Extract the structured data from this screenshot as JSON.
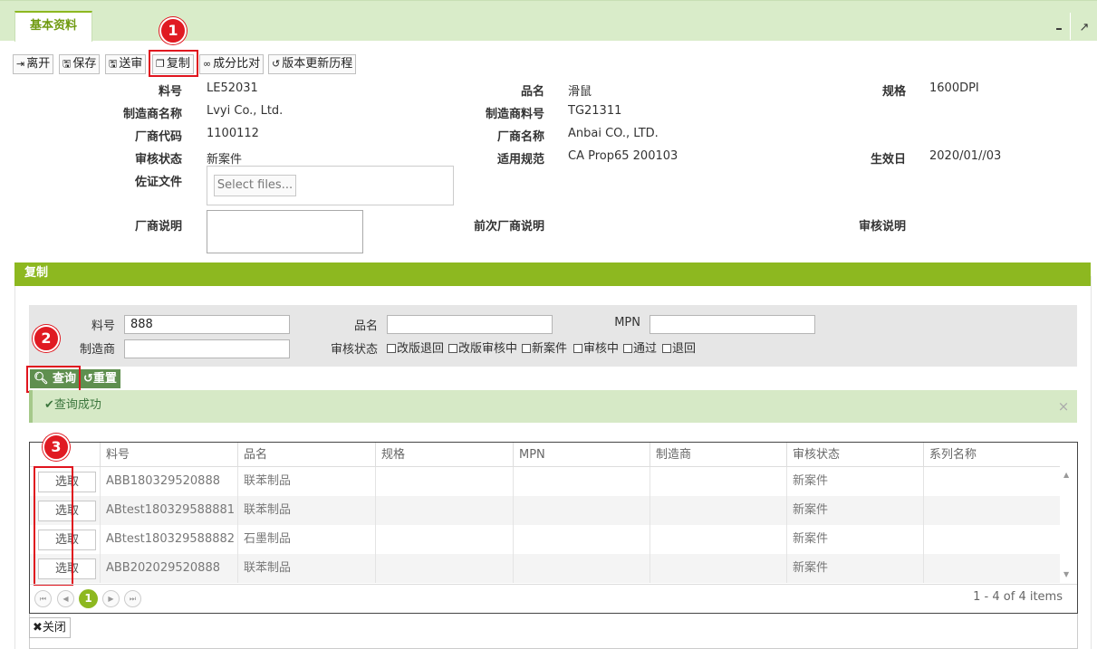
{
  "tab": {
    "label": "基本资料"
  },
  "window": {
    "minimize": "–",
    "maximize": "↗"
  },
  "toolbar": {
    "leave": "离开",
    "save": "保存",
    "submit": "送审",
    "copy": "复制",
    "compare": "成分比对",
    "history": "版本更新历程"
  },
  "badges": {
    "one": "1",
    "two": "2",
    "three": "3"
  },
  "form": {
    "part_no_label": "料号",
    "part_no": "LE52031",
    "product_name_label": "品名",
    "product_name": "滑鼠",
    "spec_label": "规格",
    "spec": "1600DPI",
    "manufacturer_name_label": "制造商名称",
    "manufacturer_name": "Lvyi Co., Ltd.",
    "manufacturer_part_label": "制造商料号",
    "manufacturer_part": "TG21311",
    "vendor_code_label": "厂商代码",
    "vendor_code": "1100112",
    "vendor_name_label": "厂商名称",
    "vendor_name": "Anbai CO., LTD.",
    "review_status_label": "审核状态",
    "review_status": "新案件",
    "regulation_label": "适用规范",
    "regulation": "CA Prop65 200103",
    "effective_date_label": "生效日",
    "effective_date": "2020/01//03",
    "evidence_label": "佐证文件",
    "select_files": "Select files...",
    "vendor_note_label": "厂商说明",
    "prev_vendor_note_label": "前次厂商说明",
    "review_note_label": "审核说明"
  },
  "copy_section": {
    "title": "复制",
    "search": {
      "part_no_label": "料号",
      "part_no_value": "888",
      "product_name_label": "品名",
      "product_name_value": "",
      "mpn_label": "MPN",
      "mpn_value": "",
      "manufacturer_label": "制造商",
      "manufacturer_value": "",
      "status_label": "审核状态",
      "status_options": [
        "改版退回",
        "改版审核中",
        "新案件",
        "审核中",
        "通过",
        "退回"
      ]
    },
    "query_button": "查询",
    "reset_button": "重置",
    "alert": "查询成功",
    "alert_close": "×",
    "columns": [
      "料号",
      "品名",
      "规格",
      "MPN",
      "制造商",
      "审核状态",
      "系列名称"
    ],
    "select_label": "选取",
    "rows": [
      {
        "part_no": "ABB180329520888",
        "name": "联苯制品",
        "spec": "",
        "mpn": "",
        "maker": "",
        "status": "新案件",
        "series": ""
      },
      {
        "part_no": "ABtest180329588881",
        "name": "联苯制品",
        "spec": "",
        "mpn": "",
        "maker": "",
        "status": "新案件",
        "series": ""
      },
      {
        "part_no": "ABtest180329588882",
        "name": "石墨制品",
        "spec": "",
        "mpn": "",
        "maker": "",
        "status": "新案件",
        "series": ""
      },
      {
        "part_no": "ABB202029520888",
        "name": "联苯制品",
        "spec": "",
        "mpn": "",
        "maker": "",
        "status": "新案件",
        "series": ""
      }
    ],
    "pager": {
      "current": "1",
      "info": "1 - 4 of 4 items"
    },
    "close_button": "关闭"
  }
}
